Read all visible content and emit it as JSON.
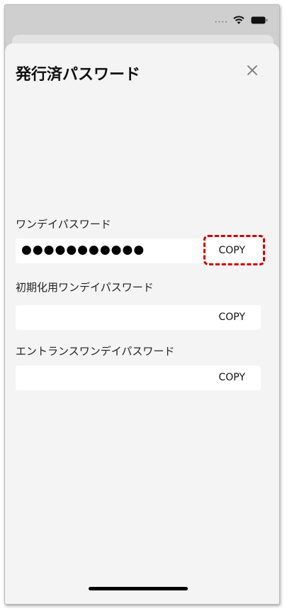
{
  "status_bar": {
    "signal_dots": "····",
    "icons": [
      "wifi-icon",
      "battery-icon"
    ]
  },
  "sheet": {
    "title": "発行済パスワード",
    "close_icon": "close-icon"
  },
  "fields": [
    {
      "label": "ワンデイパスワード",
      "value": "●●●●●●●●●●●",
      "copy_label": "COPY"
    },
    {
      "label": "初期化用ワンデイパスワード",
      "value": "",
      "copy_label": "COPY"
    },
    {
      "label": "エントランスワンデイパスワード",
      "value": "",
      "copy_label": "COPY"
    }
  ],
  "colors": {
    "sheet_background": "#f4f4f4",
    "field_background": "#ffffff",
    "highlight": "#d20000"
  }
}
